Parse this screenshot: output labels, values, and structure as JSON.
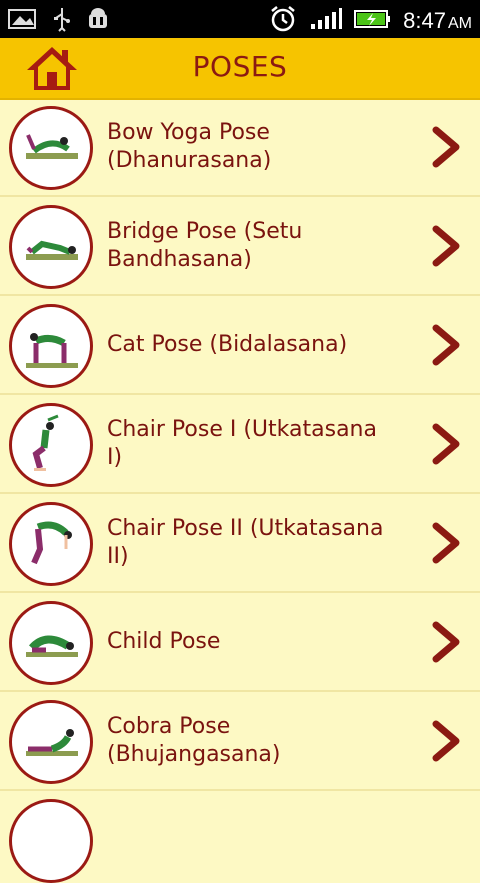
{
  "status_bar": {
    "time": "8:47",
    "ampm": "AM",
    "icons": [
      "picture-icon",
      "usb-icon",
      "android-debug-icon",
      "alarm-icon",
      "signal-icon",
      "battery-charging-icon"
    ]
  },
  "header": {
    "title": "POSES",
    "home_icon": "home-icon",
    "accent": "#f6c400",
    "title_color": "#8b1a12"
  },
  "poses": [
    {
      "label": "Bow Yoga Pose (Dhanurasana)"
    },
    {
      "label": "Bridge Pose (Setu Bandhasana)"
    },
    {
      "label": "Cat Pose (Bidalasana)"
    },
    {
      "label": "Chair Pose I (Utkatasana I)"
    },
    {
      "label": "Chair Pose II (Utkatasana II)"
    },
    {
      "label": "Child Pose"
    },
    {
      "label": "Cobra Pose (Bhujangasana)"
    }
  ],
  "colors": {
    "background": "#fdf9c4",
    "text": "#7a130f",
    "chevron": "#8b1a12"
  }
}
